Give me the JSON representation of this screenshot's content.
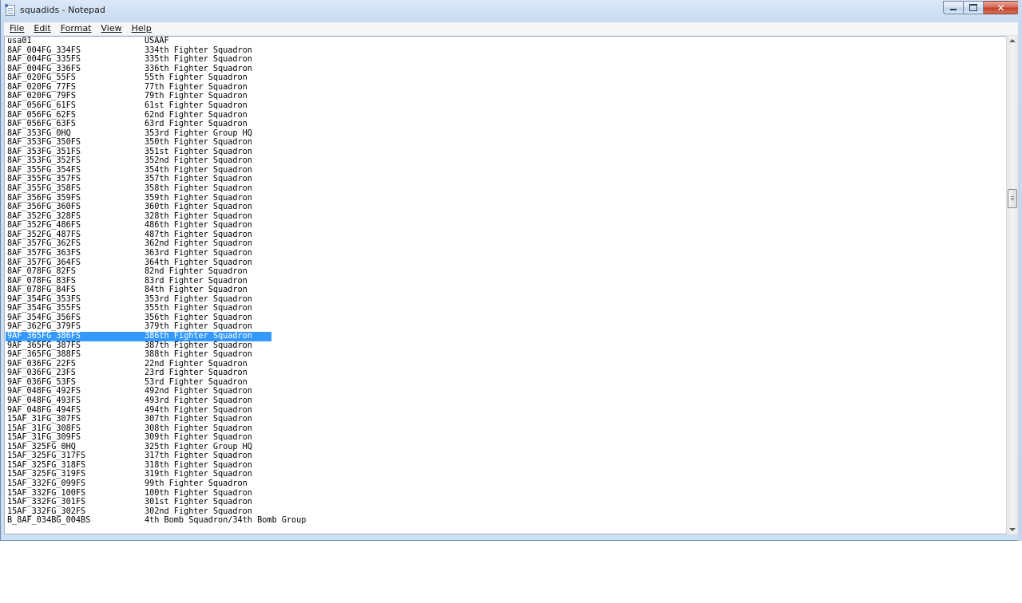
{
  "window": {
    "title": "squadids - Notepad"
  },
  "menu": [
    {
      "label": "File"
    },
    {
      "label": "Edit"
    },
    {
      "label": "Format"
    },
    {
      "label": "View"
    },
    {
      "label": "Help"
    }
  ],
  "lines": [
    {
      "id": "usa01",
      "name": "USAAF"
    },
    {
      "id": "8AF_004FG_334FS",
      "name": "334th Fighter Squadron"
    },
    {
      "id": "8AF_004FG_335FS",
      "name": "335th Fighter Squadron"
    },
    {
      "id": "8AF_004FG_336FS",
      "name": "336th Fighter Squadron"
    },
    {
      "id": "8AF_020FG_55FS",
      "name": "55th Fighter Squadron"
    },
    {
      "id": "8AF_020FG_77FS",
      "name": "77th Fighter Squadron"
    },
    {
      "id": "8AF_020FG_79FS",
      "name": "79th Fighter Squadron"
    },
    {
      "id": "8AF_056FG_61FS",
      "name": "61st Fighter Squadron"
    },
    {
      "id": "8AF_056FG_62FS",
      "name": "62nd Fighter Squadron"
    },
    {
      "id": "8AF_056FG_63FS",
      "name": "63rd Fighter Squadron"
    },
    {
      "id": "8AF_353FG_0HQ",
      "name": "353rd Fighter Group HQ"
    },
    {
      "id": "8AF_353FG_350FS",
      "name": "350th Fighter Squadron"
    },
    {
      "id": "8AF_353FG_351FS",
      "name": "351st Fighter Squadron"
    },
    {
      "id": "8AF_353FG_352FS",
      "name": "352nd Fighter Squadron"
    },
    {
      "id": "8AF_355FG_354FS",
      "name": "354th Fighter Squadron"
    },
    {
      "id": "8AF_355FG_357FS",
      "name": "357th Fighter Squadron"
    },
    {
      "id": "8AF_355FG_358FS",
      "name": "358th Fighter Squadron"
    },
    {
      "id": "8AF_356FG_359FS",
      "name": "359th Fighter Squadron"
    },
    {
      "id": "8AF_356FG_360FS",
      "name": "360th Fighter Squadron"
    },
    {
      "id": "8AF_352FG_328FS",
      "name": "328th Fighter Squadron"
    },
    {
      "id": "8AF_352FG_486FS",
      "name": "486th Fighter Squadron"
    },
    {
      "id": "8AF_352FG_487FS",
      "name": "487th Fighter Squadron"
    },
    {
      "id": "8AF_357FG_362FS",
      "name": "362nd Fighter Squadron"
    },
    {
      "id": "8AF_357FG_363FS",
      "name": "363rd Fighter Squadron"
    },
    {
      "id": "8AF_357FG_364FS",
      "name": "364th Fighter Squadron"
    },
    {
      "id": "8AF_078FG_82FS",
      "name": "82nd Fighter Squadron"
    },
    {
      "id": "8AF_078FG_83FS",
      "name": "83rd Fighter Squadron"
    },
    {
      "id": "8AF_078FG_84FS",
      "name": "84th Fighter Squadron"
    },
    {
      "id": "9AF_354FG_353FS",
      "name": "353rd Fighter Squadron"
    },
    {
      "id": "9AF_354FG_355FS",
      "name": "355th Fighter Squadron"
    },
    {
      "id": "9AF_354FG_356FS",
      "name": "356th Fighter Squadron"
    },
    {
      "id": "9AF_362FG_379FS",
      "name": "379th Fighter Squadron"
    },
    {
      "id": "9AF_365FG_386FS",
      "name": "386th Fighter Squadron",
      "selected": true
    },
    {
      "id": "9AF_365FG_387FS",
      "name": "387th Fighter Squadron"
    },
    {
      "id": "9AF_365FG_388FS",
      "name": "388th Fighter Squadron"
    },
    {
      "id": "9AF_036FG_22FS",
      "name": "22nd Fighter Squadron"
    },
    {
      "id": "9AF_036FG_23FS",
      "name": "23rd Fighter Squadron"
    },
    {
      "id": "9AF_036FG_53FS",
      "name": "53rd Fighter Squadron"
    },
    {
      "id": "9AF_048FG_492FS",
      "name": "492nd Fighter Squadron"
    },
    {
      "id": "9AF_048FG_493FS",
      "name": "493rd Fighter Squadron"
    },
    {
      "id": "9AF_048FG_494FS",
      "name": "494th Fighter Squadron"
    },
    {
      "id": "15AF_31FG_307FS",
      "name": "307th Fighter Squadron"
    },
    {
      "id": "15AF_31FG_308FS",
      "name": "308th Fighter Squadron"
    },
    {
      "id": "15AF_31FG_309FS",
      "name": "309th Fighter Squadron"
    },
    {
      "id": "15AF_325FG_0HQ",
      "name": "325th Fighter Group HQ"
    },
    {
      "id": "15AF_325FG_317FS",
      "name": "317th Fighter Squadron"
    },
    {
      "id": "15AF_325FG_318FS",
      "name": "318th Fighter Squadron"
    },
    {
      "id": "15AF_325FG_319FS",
      "name": "319th Fighter Squadron"
    },
    {
      "id": "15AF_332FG_099FS",
      "name": "99th Fighter Squadron"
    },
    {
      "id": "15AF_332FG_100FS",
      "name": "100th Fighter Squadron"
    },
    {
      "id": "15AF_332FG_301FS",
      "name": "301st Fighter Squadron"
    },
    {
      "id": "15AF_332FG_302FS",
      "name": "302nd Fighter Squadron"
    },
    {
      "id": "B_8AF_034BG_004BS",
      "name": "4th Bomb Squadron/34th Bomb Group"
    }
  ],
  "colors": {
    "selection": "#3399ff",
    "titlebar": "#c7daf1",
    "close": "#c2412a"
  },
  "icons": {
    "app": "notepad-icon",
    "minimize": "minimize-icon",
    "maximize": "maximize-icon",
    "close": "close-icon"
  }
}
